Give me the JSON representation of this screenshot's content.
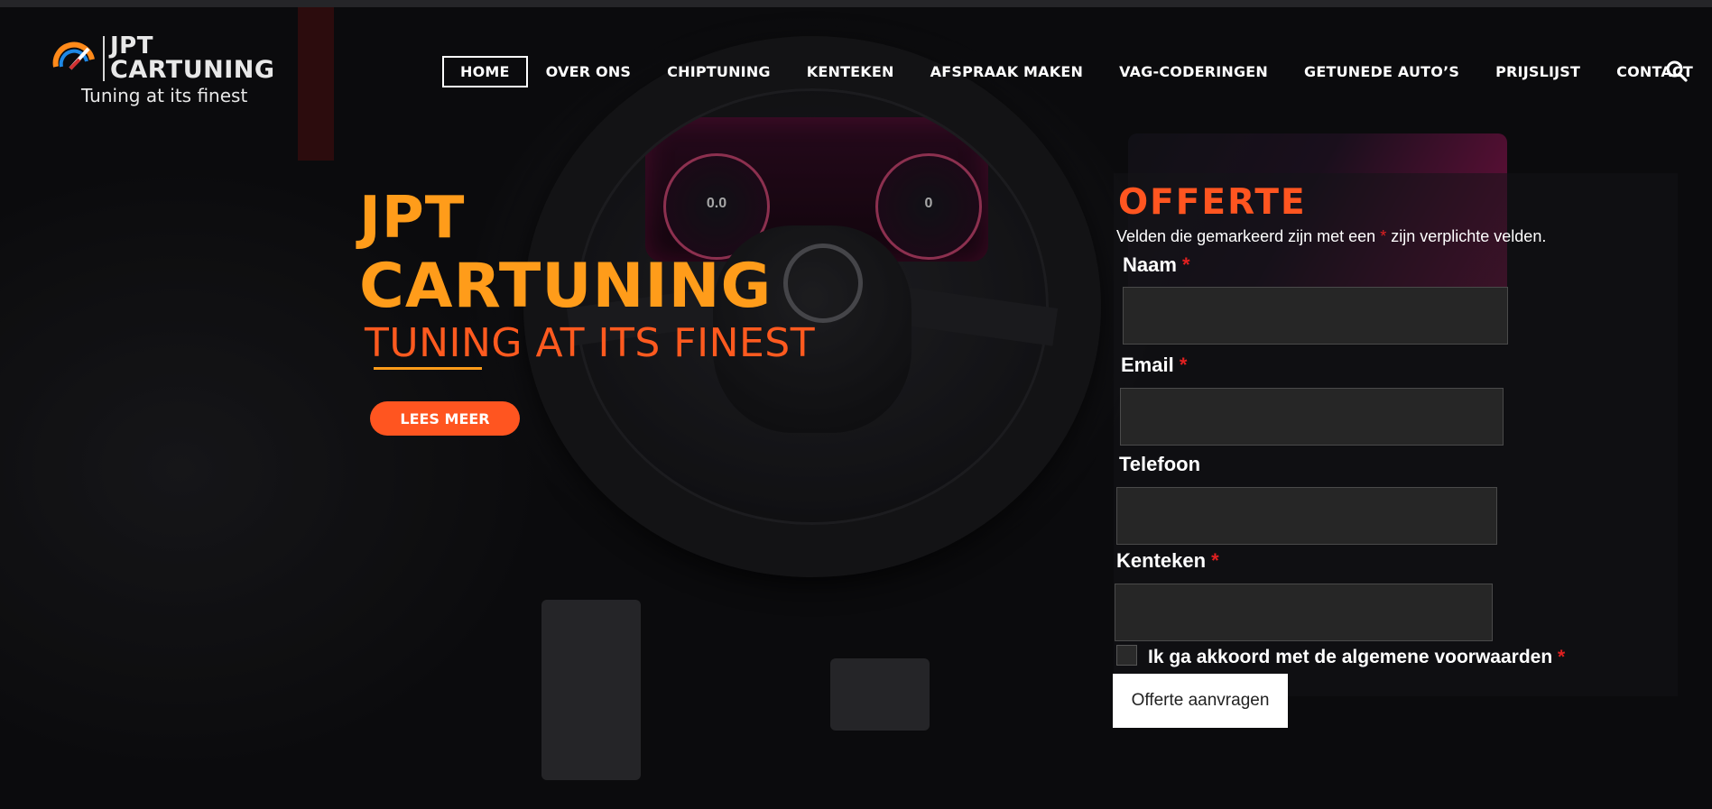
{
  "brand": {
    "line1": "JPT",
    "line2": "CARTUNING",
    "tagline": "Tuning at its finest"
  },
  "nav": {
    "items": [
      {
        "label": "HOME",
        "active": true
      },
      {
        "label": "OVER ONS",
        "active": false
      },
      {
        "label": "CHIPTUNING",
        "active": false
      },
      {
        "label": "KENTEKEN",
        "active": false
      },
      {
        "label": "AFSPRAAK MAKEN",
        "active": false
      },
      {
        "label": "VAG-CODERINGEN",
        "active": false
      },
      {
        "label": "GETUNEDE AUTO’S",
        "active": false
      },
      {
        "label": "PRIJSLIJST",
        "active": false
      },
      {
        "label": "CONTACT",
        "active": false
      }
    ],
    "search_icon": "search-icon"
  },
  "hero": {
    "title_line1": "JPT",
    "title_line2": "CARTUNING",
    "subtitle": "TUNING AT ITS FINEST",
    "cta_label": "LEES MEER",
    "accent_color": "#ff9c1a",
    "cta_color": "#ff5520"
  },
  "dashboard": {
    "gauge_left": "0.0",
    "gauge_right": "0"
  },
  "form": {
    "title": "OFFERTE",
    "note_before": "Velden die gemarkeerd zijn met een",
    "note_marker": "*",
    "note_after": "zijn verplichte velden.",
    "required_marker": "*",
    "fields": {
      "naam": {
        "label": "Naam",
        "required": true,
        "value": ""
      },
      "email": {
        "label": "Email",
        "required": true,
        "value": ""
      },
      "telefoon": {
        "label": "Telefoon",
        "required": false,
        "value": ""
      },
      "kenteken": {
        "label": "Kenteken",
        "required": true,
        "value": ""
      }
    },
    "consent_label": "Ik ga akkoord met de algemene voorwaarden",
    "consent_checked": false,
    "submit_label": "Offerte aanvragen"
  }
}
